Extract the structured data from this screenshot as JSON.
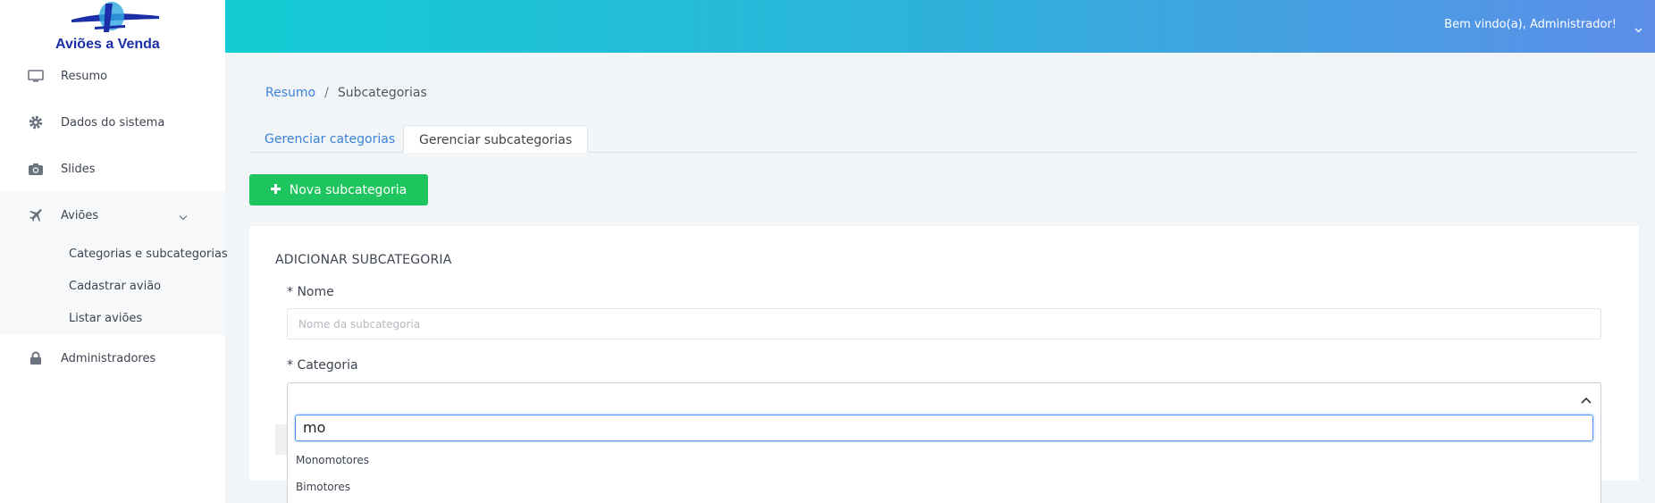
{
  "brand": {
    "name": "Aviões a Venda"
  },
  "sidebar": {
    "items": [
      {
        "label": "Resumo",
        "icon": "monitor-icon"
      },
      {
        "label": "Dados do sistema",
        "icon": "gear-icon"
      },
      {
        "label": "Slides",
        "icon": "camera-icon"
      },
      {
        "label": "Aviões",
        "icon": "plane-icon"
      },
      {
        "label": "Administradores",
        "icon": "lock-icon"
      }
    ],
    "submenu": [
      {
        "label": "Categorias e subcategorias"
      },
      {
        "label": "Cadastrar avião"
      },
      {
        "label": "Listar aviões"
      }
    ]
  },
  "header": {
    "welcome": "Bem vindo(a), Administrador!"
  },
  "breadcrumb": {
    "root": "Resumo",
    "separator": "/",
    "current": "Subcategorias"
  },
  "tabs": [
    {
      "label": "Gerenciar categorias",
      "active": false
    },
    {
      "label": "Gerenciar subcategorias",
      "active": true
    }
  ],
  "new_button": {
    "label": "Nova subcategoria"
  },
  "form": {
    "title": "ADICIONAR SUBCATEGORIA",
    "name_label": "* Nome",
    "name_placeholder": "Nome da subcategoria",
    "category_label": "* Categoria",
    "category_search": "mo",
    "category_options": [
      "Monomotores",
      "Bimotores"
    ]
  },
  "colors": {
    "header_start": "#14cdd4",
    "header_end": "#5c8ee8",
    "link": "#3b82d6",
    "success": "#1ec45d"
  }
}
